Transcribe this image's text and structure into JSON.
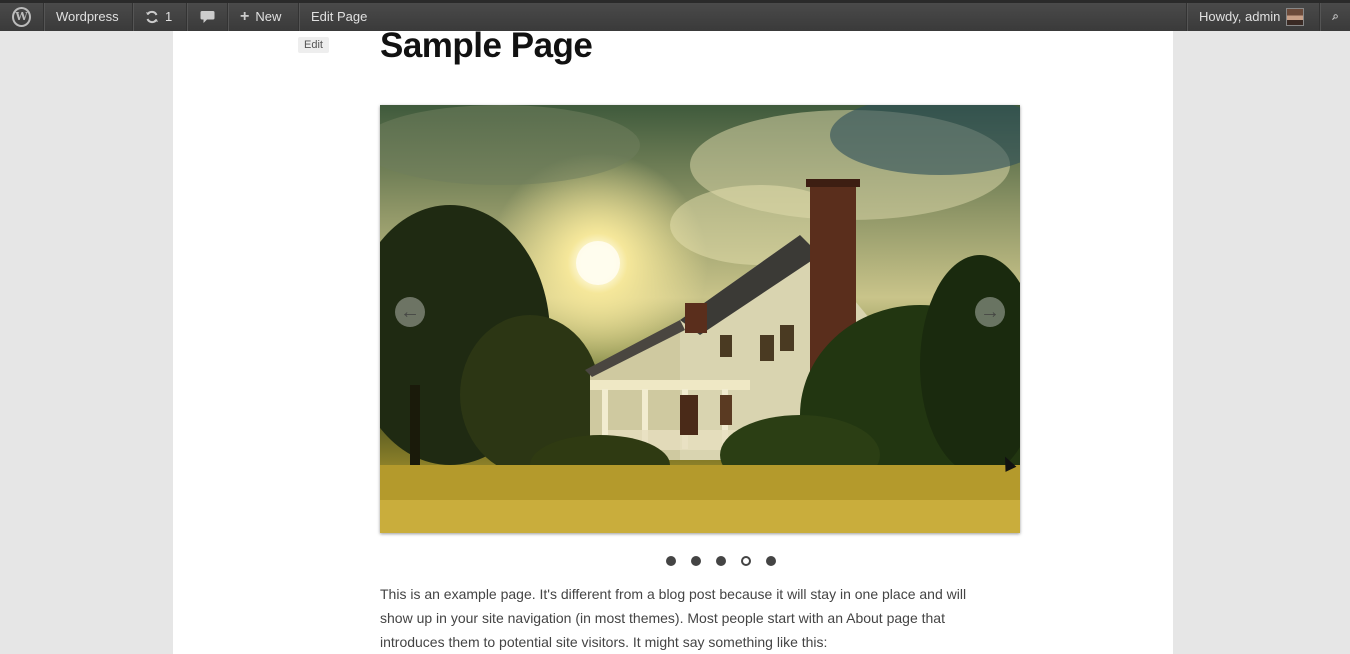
{
  "adminbar": {
    "logo_icon": "wordpress-logo-icon",
    "site_name": "Wordpress",
    "updates_count": "1",
    "new_label": "New",
    "edit_page_label": "Edit Page",
    "howdy_label": "Howdy, admin"
  },
  "page": {
    "edit_label": "Edit",
    "title": "Sample Page",
    "slider": {
      "prev_icon": "arrow-left-icon",
      "next_icon": "arrow-right-icon",
      "dots": [
        {
          "active": false
        },
        {
          "active": false
        },
        {
          "active": false
        },
        {
          "active": true
        },
        {
          "active": false
        }
      ]
    },
    "body_text": "This is an example page. It's different from a blog post because it will stay in one place and will show up in your site navigation (in most themes). Most people start with an About page that introduces them to potential site visitors. It might say something like this:"
  },
  "colors": {
    "adminbar_bg": "#464646",
    "page_bg": "#ffffff",
    "outer_bg": "#e6e6e6"
  }
}
